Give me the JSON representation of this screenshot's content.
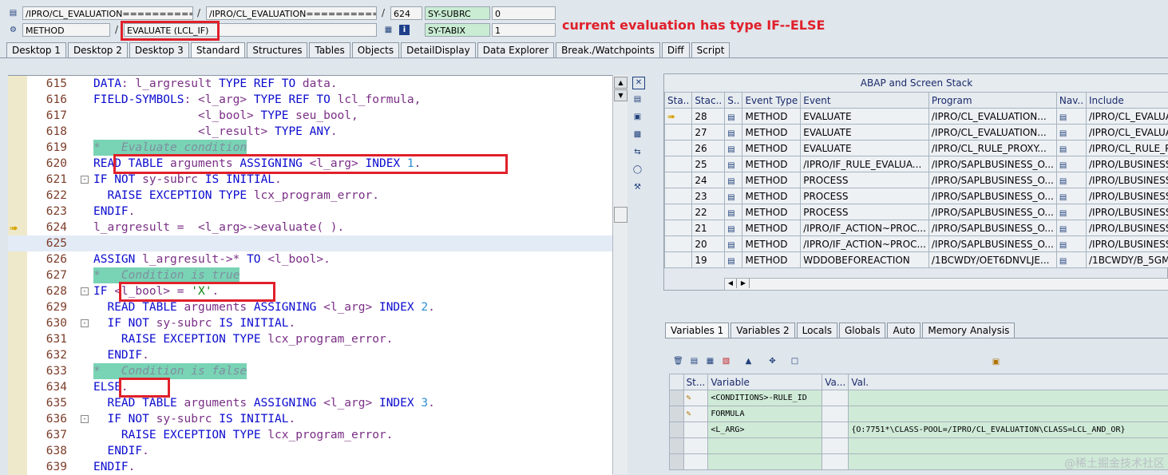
{
  "header": {
    "row1": {
      "prog1": "/IPRO/CL_EVALUATION==========",
      "prog2": "/IPRO/CL_EVALUATION==========",
      "line": "624",
      "sysvar1": "SY-SUBRC",
      "sysval1": "0"
    },
    "row2": {
      "type": "METHOD",
      "method": "EVALUATE (LCL_IF)",
      "sysvar2": "SY-TABIX",
      "sysval2": "1"
    },
    "slash": "/"
  },
  "annotation": "current evaluation has type IF--ELSE",
  "tabs": [
    "Desktop 1",
    "Desktop 2",
    "Desktop 3",
    "Standard",
    "Structures",
    "Tables",
    "Objects",
    "DetailDisplay",
    "Data Explorer",
    "Break./Watchpoints",
    "Diff",
    "Script"
  ],
  "code_lines": [
    {
      "n": "615",
      "t": "DATA: l_argresult TYPE REF TO data."
    },
    {
      "n": "616",
      "t": "FIELD-SYMBOLS: <l_arg> TYPE REF TO lcl_formula,"
    },
    {
      "n": "617",
      "t": "               <l_bool> TYPE seu_bool,"
    },
    {
      "n": "618",
      "t": "               <l_result> TYPE ANY."
    },
    {
      "n": "619",
      "t": "*   Evaluate condition"
    },
    {
      "n": "620",
      "t": "READ TABLE arguments ASSIGNING <l_arg> INDEX 1."
    },
    {
      "n": "621",
      "t": "IF NOT sy-subrc IS INITIAL."
    },
    {
      "n": "622",
      "t": "  RAISE EXCEPTION TYPE lcx_program_error."
    },
    {
      "n": "623",
      "t": "ENDIF."
    },
    {
      "n": "624",
      "t": "l_argresult =  <l_arg>->evaluate( )."
    },
    {
      "n": "625",
      "t": ""
    },
    {
      "n": "626",
      "t": "ASSIGN l_argresult->* TO <l_bool>."
    },
    {
      "n": "627",
      "t": "*   Condition is true"
    },
    {
      "n": "628",
      "t": "IF <l_bool> = 'X'."
    },
    {
      "n": "629",
      "t": "  READ TABLE arguments ASSIGNING <l_arg> INDEX 2."
    },
    {
      "n": "630",
      "t": "  IF NOT sy-subrc IS INITIAL."
    },
    {
      "n": "631",
      "t": "    RAISE EXCEPTION TYPE lcx_program_error."
    },
    {
      "n": "632",
      "t": "  ENDIF."
    },
    {
      "n": "633",
      "t": "*   Condition is false"
    },
    {
      "n": "634",
      "t": "ELSE."
    },
    {
      "n": "635",
      "t": "  READ TABLE arguments ASSIGNING <l_arg> INDEX 3."
    },
    {
      "n": "636",
      "t": "  IF NOT sy-subrc IS INITIAL."
    },
    {
      "n": "637",
      "t": "    RAISE EXCEPTION TYPE lcx_program_error."
    },
    {
      "n": "638",
      "t": "  ENDIF."
    },
    {
      "n": "639",
      "t": "ENDIF."
    }
  ],
  "stack": {
    "title": "ABAP and Screen Stack",
    "columns": [
      "Sta..",
      "Stac..",
      "S..",
      "Event Type",
      "Event",
      "Program",
      "Nav..",
      "Include"
    ],
    "rows": [
      {
        "stac": "28",
        "type": "METHOD",
        "event": "EVALUATE",
        "program": "/IPRO/CL_EVALUATION...",
        "include": "/IPRO/CL_EVALUAT"
      },
      {
        "stac": "27",
        "type": "METHOD",
        "event": "EVALUATE",
        "program": "/IPRO/CL_EVALUATION...",
        "include": "/IPRO/CL_EVALUAT"
      },
      {
        "stac": "26",
        "type": "METHOD",
        "event": "EVALUATE",
        "program": "/IPRO/CL_RULE_PROXY...",
        "include": "/IPRO/CL_RULE_PR"
      },
      {
        "stac": "25",
        "type": "METHOD",
        "event": "/IPRO/IF_RULE_EVALUA...",
        "program": "/IPRO/SAPLBUSINESS_O...",
        "include": "/IPRO/LBUSINESS_"
      },
      {
        "stac": "24",
        "type": "METHOD",
        "event": "PROCESS",
        "program": "/IPRO/SAPLBUSINESS_O...",
        "include": "/IPRO/LBUSINESS_"
      },
      {
        "stac": "23",
        "type": "METHOD",
        "event": "PROCESS",
        "program": "/IPRO/SAPLBUSINESS_O...",
        "include": "/IPRO/LBUSINESS_"
      },
      {
        "stac": "22",
        "type": "METHOD",
        "event": "PROCESS",
        "program": "/IPRO/SAPLBUSINESS_O...",
        "include": "/IPRO/LBUSINESS_"
      },
      {
        "stac": "21",
        "type": "METHOD",
        "event": "/IPRO/IF_ACTION~PROC...",
        "program": "/IPRO/SAPLBUSINESS_O...",
        "include": "/IPRO/LBUSINESS_"
      },
      {
        "stac": "20",
        "type": "METHOD",
        "event": "/IPRO/IF_ACTION~PROC...",
        "program": "/IPRO/SAPLBUSINESS_O...",
        "include": "/IPRO/LBUSINESS_"
      },
      {
        "stac": "19",
        "type": "METHOD",
        "event": "WDDOBEFOREACTION",
        "program": "/1BCWDY/OET6DNVLJE...",
        "include": "/1BCWDY/B_5GMD"
      }
    ]
  },
  "var_tabs": [
    "Variables 1",
    "Variables 2",
    "Locals",
    "Globals",
    "Auto",
    "Memory Analysis"
  ],
  "vars": {
    "columns": [
      "St...",
      "Variable",
      "Va...",
      "Val."
    ],
    "rows": [
      {
        "variable": "<CONDITIONS>-RULE_ID",
        "val": ""
      },
      {
        "variable": "FORMULA",
        "val": ""
      },
      {
        "variable": "<L_ARG>",
        "val": "{O:7751*\\CLASS-POOL=/IPRO/CL_EVALUATION\\CLASS=LCL_AND_OR}"
      },
      {
        "variable": "",
        "val": ""
      },
      {
        "variable": "",
        "val": ""
      }
    ]
  },
  "watermark": "@稀土掘金技术社区"
}
